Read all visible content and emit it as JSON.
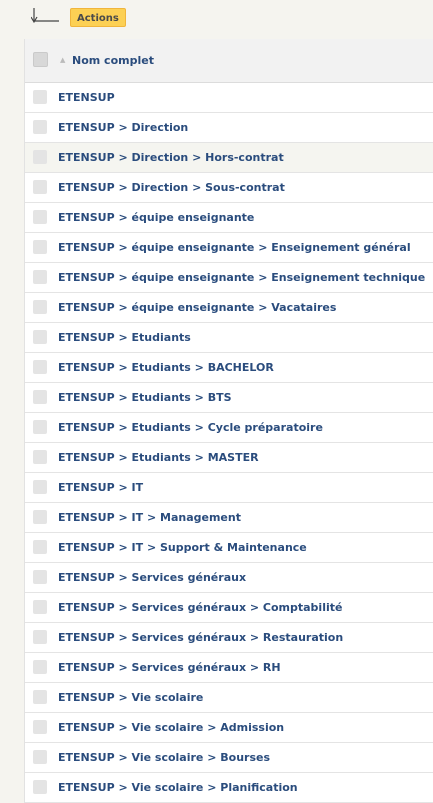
{
  "toolbar": {
    "actions_label": "Actions"
  },
  "table": {
    "header": {
      "sort_icon": "▲",
      "label": "Nom complet"
    },
    "rows": [
      "ETENSUP",
      "ETENSUP > Direction",
      "ETENSUP > Direction > Hors-contrat",
      "ETENSUP > Direction > Sous-contrat",
      "ETENSUP > équipe enseignante",
      "ETENSUP > équipe enseignante > Enseignement général",
      "ETENSUP > équipe enseignante > Enseignement technique",
      "ETENSUP > équipe enseignante > Vacataires",
      "ETENSUP > Etudiants",
      "ETENSUP > Etudiants > BACHELOR",
      "ETENSUP > Etudiants > BTS",
      "ETENSUP > Etudiants > Cycle préparatoire",
      "ETENSUP > Etudiants > MASTER",
      "ETENSUP > IT",
      "ETENSUP > IT > Management",
      "ETENSUP > IT > Support & Maintenance",
      "ETENSUP > Services généraux",
      "ETENSUP > Services généraux > Comptabilité",
      "ETENSUP > Services généraux > Restauration",
      "ETENSUP > Services généraux > RH",
      "ETENSUP > Vie scolaire",
      "ETENSUP > Vie scolaire > Admission",
      "ETENSUP > Vie scolaire > Bourses",
      "ETENSUP > Vie scolaire > Planification"
    ]
  }
}
